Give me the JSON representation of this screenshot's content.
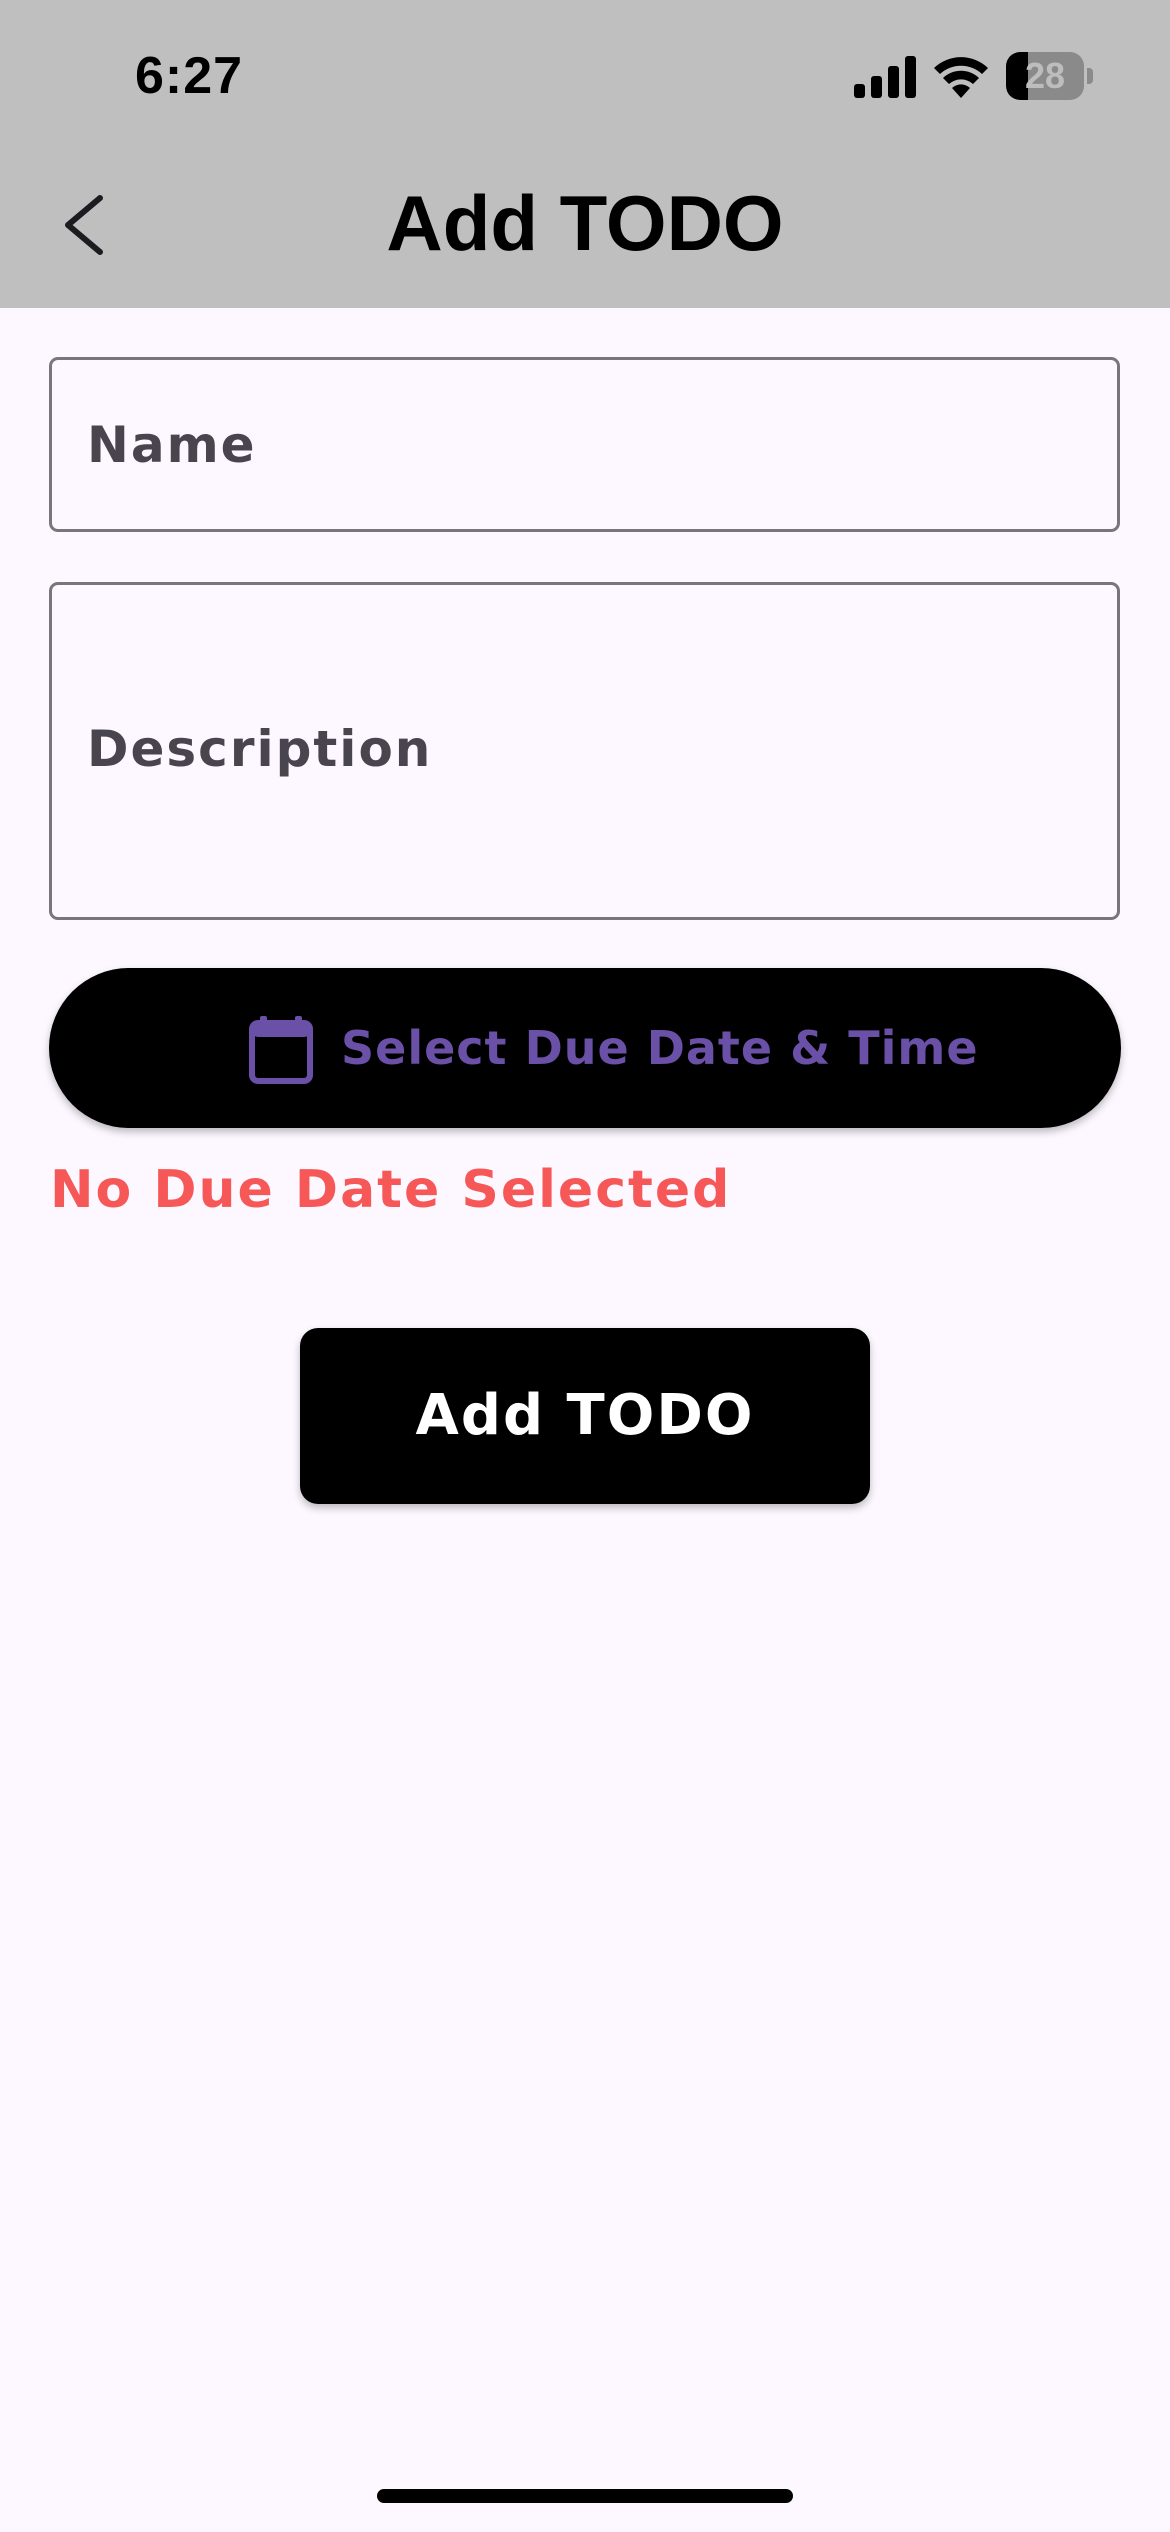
{
  "status_bar": {
    "time": "6:27",
    "battery_level": "28",
    "battery_fraction": 0.28,
    "icons": [
      "signal-icon",
      "wifi-icon",
      "battery-icon"
    ]
  },
  "app_bar": {
    "back_icon": "chevron-left-icon",
    "title": "Add TODO",
    "background": "#bfbfbf"
  },
  "form": {
    "name_placeholder": "Name",
    "name_value": "",
    "description_placeholder": "Description",
    "description_value": "",
    "due_date_button_label": "Select Due Date & Time",
    "due_date_icon": "calendar-icon",
    "due_date_status": "No Due Date Selected",
    "submit_label": "Add TODO"
  },
  "colors": {
    "page_background": "#fdf7ff",
    "accent": "#6a50a7",
    "error": "#f65757",
    "button_background": "#000000"
  }
}
